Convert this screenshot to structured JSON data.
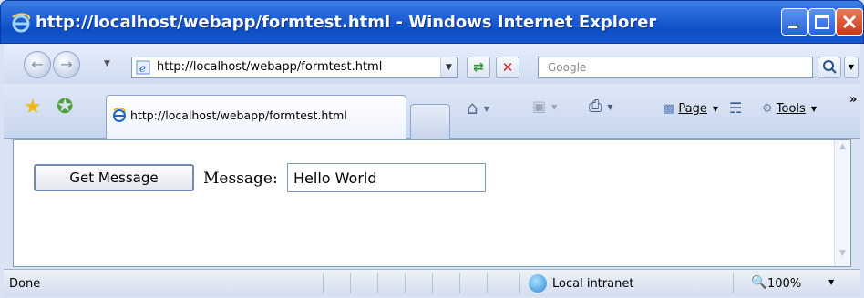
{
  "window": {
    "title": "http://localhost/webapp/formtest.html - Windows Internet Explorer"
  },
  "navigation": {
    "address_url": "http://localhost/webapp/formtest.html",
    "search_placeholder": "Google"
  },
  "tabs": [
    {
      "label": "http://localhost/webapp/formtest.html",
      "active": true
    }
  ],
  "command_bar": {
    "page_label": "Page",
    "tools_label": "Tools",
    "more_label": "»"
  },
  "page": {
    "button_label": "Get Message",
    "message_label": "Message:",
    "message_value": "Hello World"
  },
  "status_bar": {
    "status_text": "Done",
    "zone_text": "Local intranet",
    "zoom_text": "100%"
  },
  "icons": {
    "back": "back-arrow-icon",
    "forward": "forward-arrow-icon",
    "refresh": "refresh-icon",
    "stop": "stop-icon",
    "search": "search-icon",
    "favorites": "favorites-star-icon",
    "add_favorite": "add-favorite-icon",
    "home": "home-icon",
    "feeds": "feeds-icon",
    "print": "print-icon",
    "safety": "safety-icon",
    "tools": "gear-icon"
  },
  "colors": {
    "titlebar": "#2364d8",
    "chrome": "#d9e3f3",
    "content_background": "#ffffff"
  }
}
